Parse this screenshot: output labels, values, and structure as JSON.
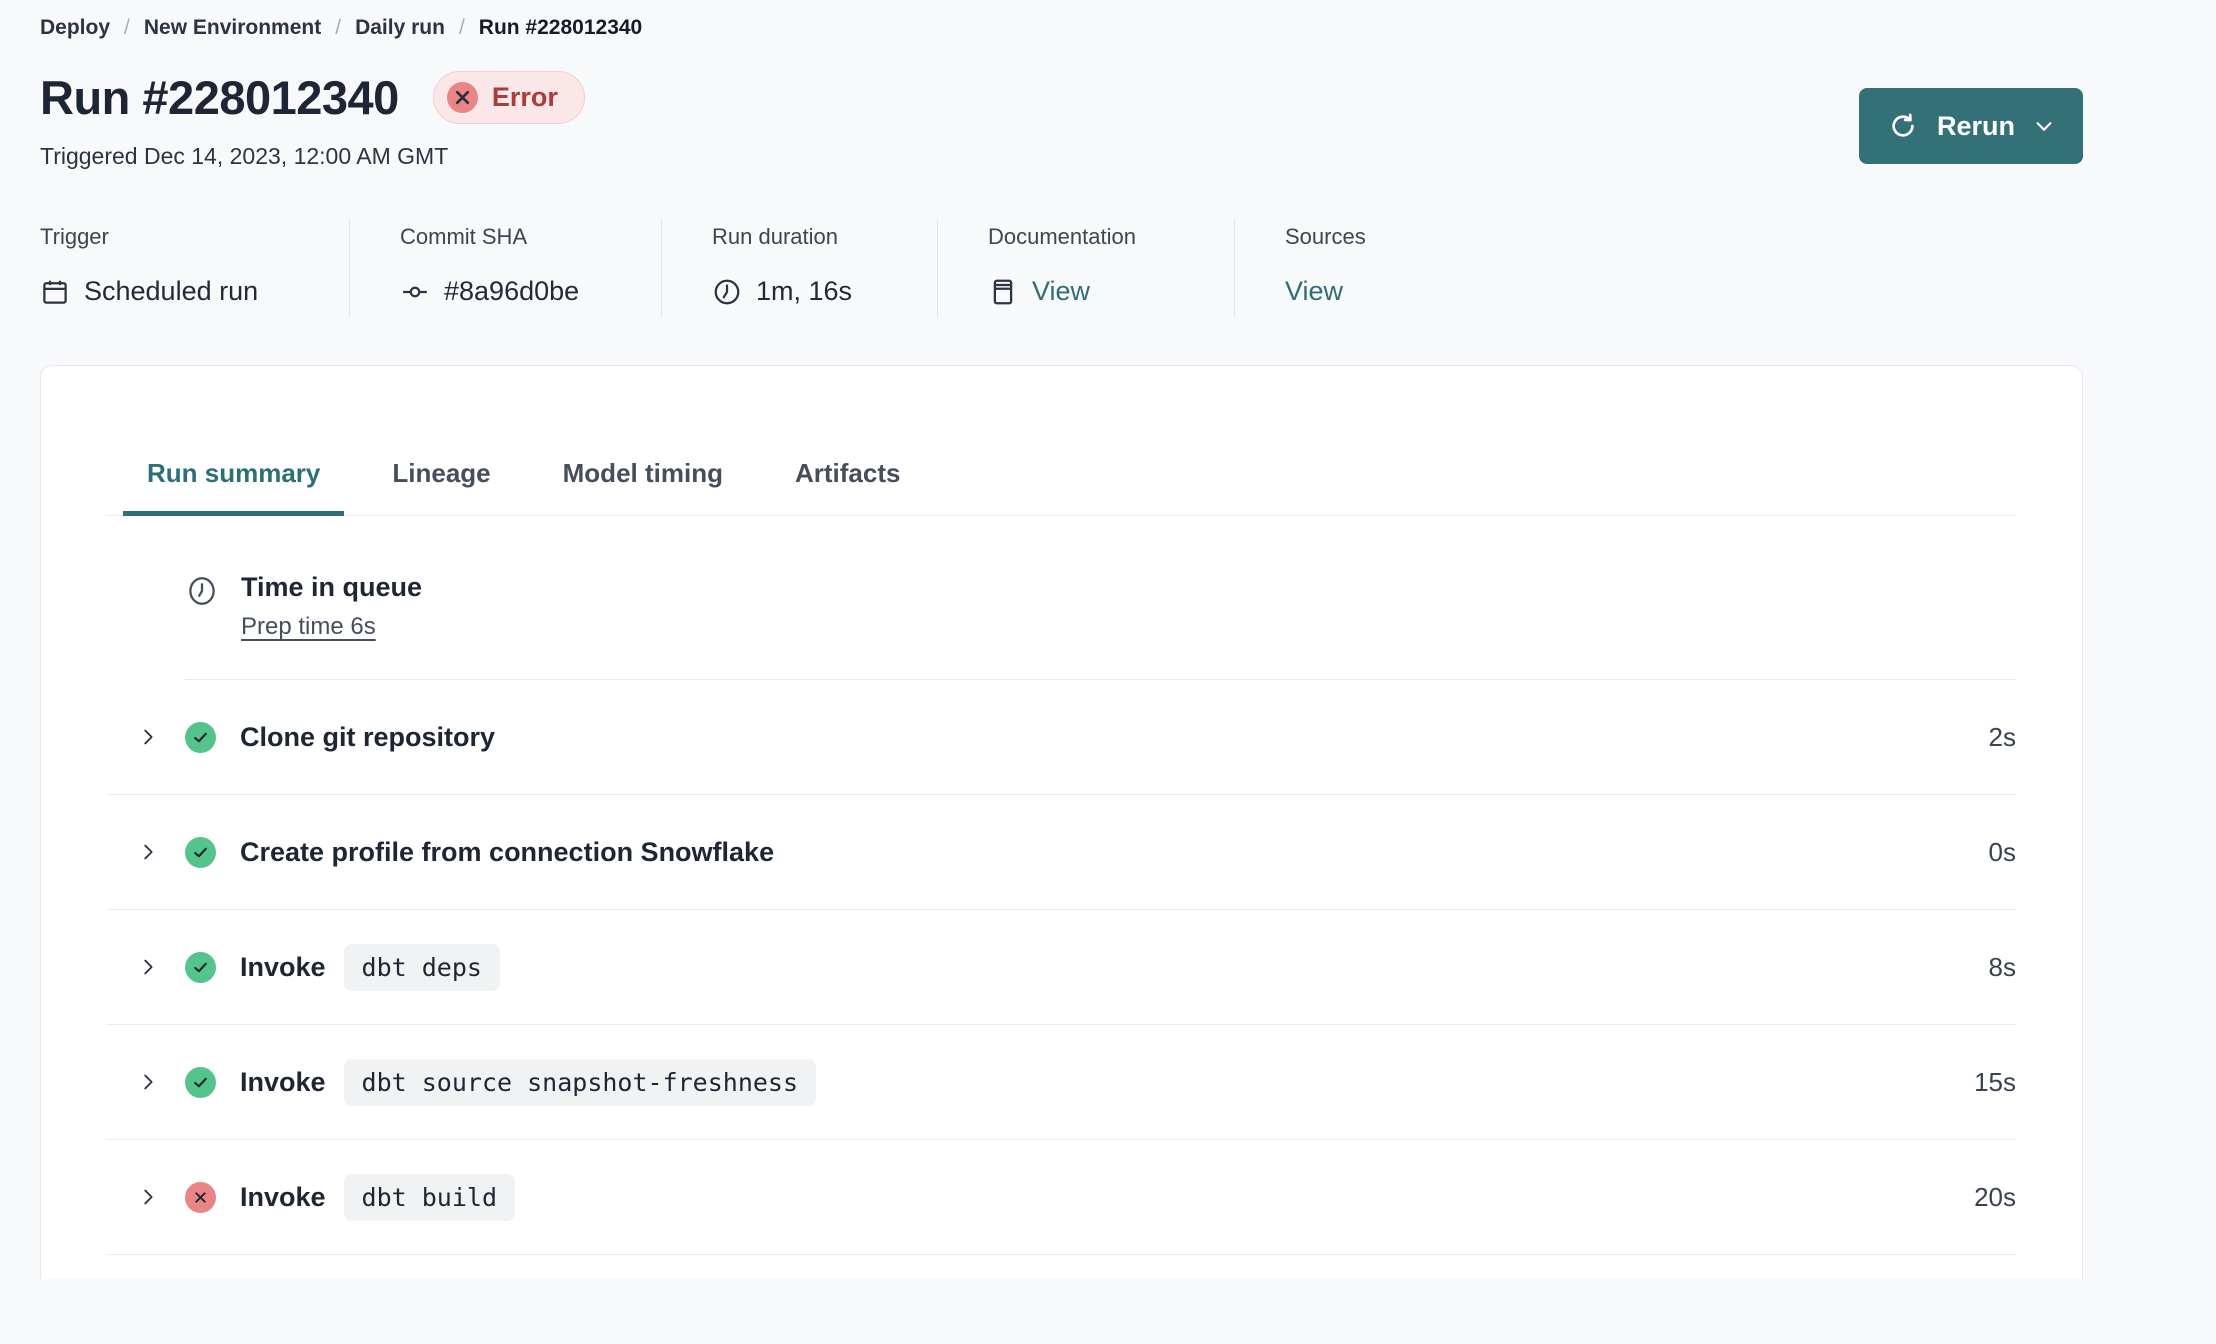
{
  "colors": {
    "accent_teal": "#337077",
    "teal_link": "#2e6e76",
    "page_bg": "#f8f9fb",
    "error_badge_bg": "#fbe7e7",
    "error_badge_border": "#f2cfcf",
    "error_text": "#a93e3e",
    "error_circle": "#e98585",
    "success_circle": "#55c48b",
    "divider": "#e7e9ee",
    "chip_bg": "#f1f2f4"
  },
  "breadcrumb": {
    "separator": "/",
    "items": [
      "Deploy",
      "New Environment",
      "Daily run",
      "Run #228012340"
    ]
  },
  "header": {
    "title": "Run #228012340",
    "status_label": "Error",
    "triggered": "Triggered Dec 14, 2023, 12:00 AM GMT",
    "rerun_label": "Rerun"
  },
  "meta": {
    "columns": [
      {
        "label": "Trigger",
        "value": "Scheduled run",
        "icon": "calendar-icon"
      },
      {
        "label": "Commit SHA",
        "value": "#8a96d0be",
        "icon": "commit-icon"
      },
      {
        "label": "Run duration",
        "value": "1m, 16s",
        "icon": "clock-icon"
      },
      {
        "label": "Documentation",
        "value": "View",
        "icon": "document-icon",
        "is_link": true
      },
      {
        "label": "Sources",
        "value": "View",
        "is_link": true
      }
    ]
  },
  "tabs": [
    {
      "label": "Run summary",
      "active": true
    },
    {
      "label": "Lineage",
      "active": false
    },
    {
      "label": "Model timing",
      "active": false
    },
    {
      "label": "Artifacts",
      "active": false
    }
  ],
  "queue": {
    "title": "Time in queue",
    "link": "Prep time 6s",
    "icon": "clock-icon"
  },
  "steps": [
    {
      "label": "Clone git repository",
      "command": null,
      "status": "success",
      "duration": "2s"
    },
    {
      "label": "Create profile from connection Snowflake",
      "command": null,
      "status": "success",
      "duration": "0s"
    },
    {
      "label": "Invoke",
      "command": "dbt deps",
      "status": "success",
      "duration": "8s"
    },
    {
      "label": "Invoke",
      "command": "dbt source snapshot-freshness",
      "status": "success",
      "duration": "15s"
    },
    {
      "label": "Invoke",
      "command": "dbt build",
      "status": "error",
      "duration": "20s"
    }
  ]
}
